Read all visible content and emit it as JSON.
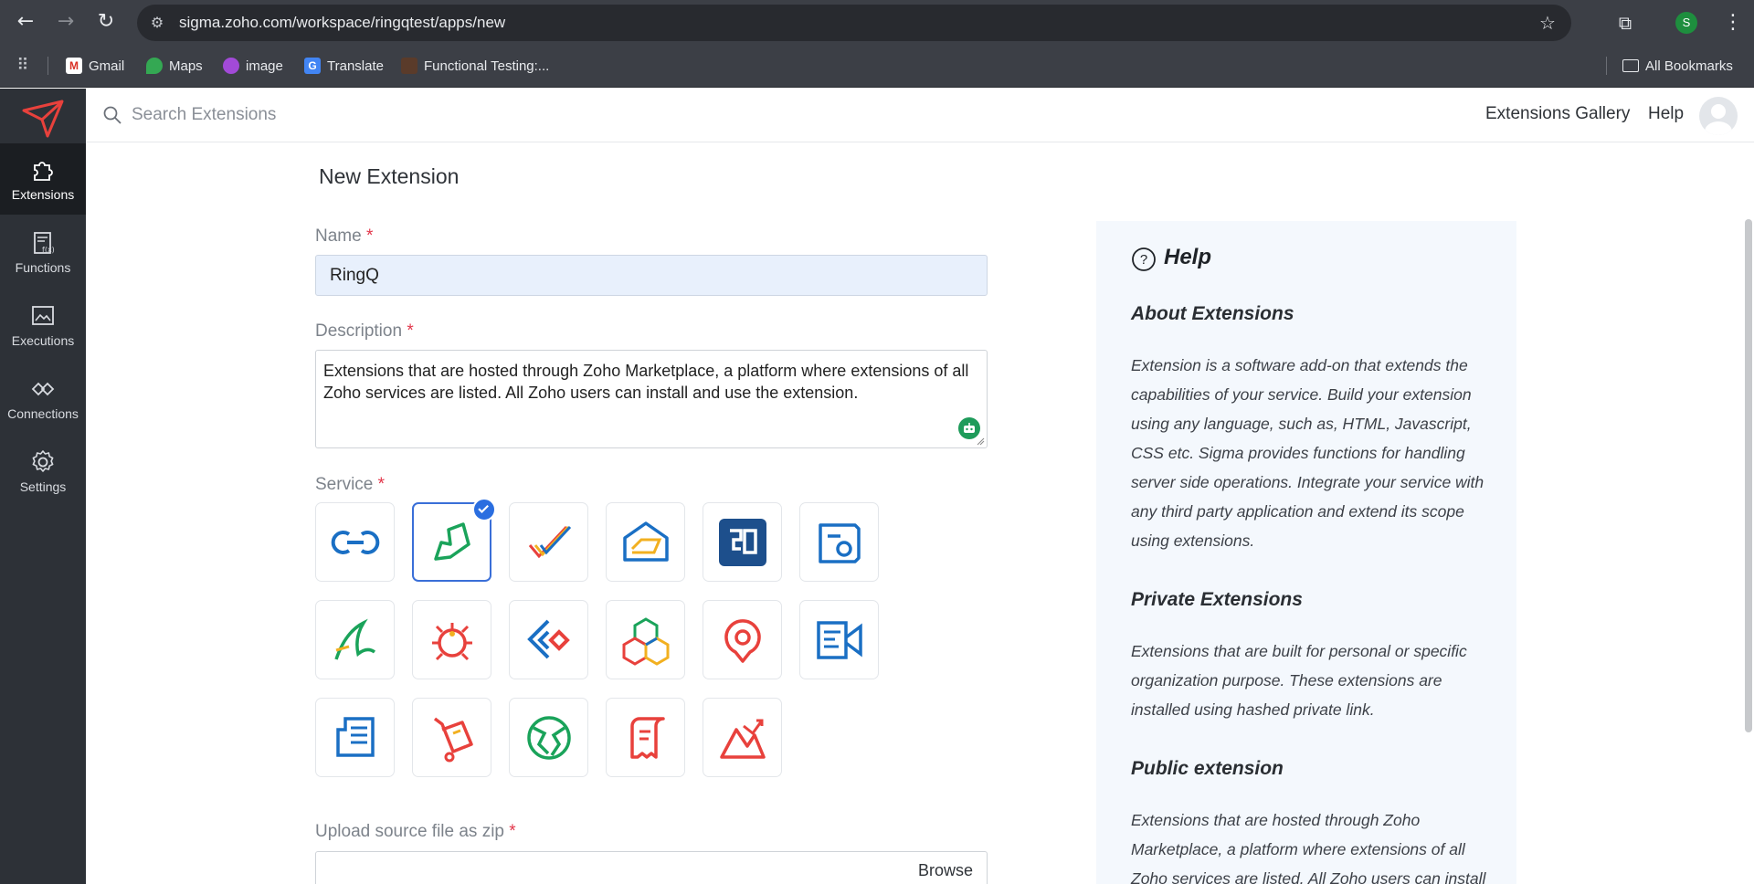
{
  "browser": {
    "url": "sigma.zoho.com/workspace/ringqtest/apps/new",
    "profile_initial": "S",
    "bookmarks": [
      {
        "label": "Gmail",
        "icon": "gmail-icon"
      },
      {
        "label": "Maps",
        "icon": "maps-icon"
      },
      {
        "label": "image",
        "icon": "image-icon"
      },
      {
        "label": "Translate",
        "icon": "translate-icon"
      },
      {
        "label": "Functional Testing:...",
        "icon": "functional-testing-icon"
      }
    ],
    "all_bookmarks": "All Bookmarks"
  },
  "sidebar": {
    "items": [
      {
        "label": "Extensions",
        "icon": "puzzle-icon",
        "active": true
      },
      {
        "label": "Functions",
        "icon": "functions-icon",
        "active": false
      },
      {
        "label": "Executions",
        "icon": "executions-icon",
        "active": false
      },
      {
        "label": "Connections",
        "icon": "connections-icon",
        "active": false
      },
      {
        "label": "Settings",
        "icon": "gear-icon",
        "active": false
      }
    ]
  },
  "topbar": {
    "search_placeholder": "Search Extensions",
    "gallery": "Extensions Gallery",
    "help": "Help"
  },
  "form": {
    "title": "New Extension",
    "name_label": "Name",
    "name_value": "RingQ",
    "description_label": "Description",
    "description_value": "Extensions that are hosted through Zoho Marketplace, a platform where extensions of all Zoho services are listed. All Zoho users can install and use the extension.",
    "service_label": "Service",
    "services": [
      {
        "name": "zoho-crm",
        "selected": false
      },
      {
        "name": "zoho-desk",
        "selected": true
      },
      {
        "name": "zoho-projects",
        "selected": false
      },
      {
        "name": "zoho-mail",
        "selected": false
      },
      {
        "name": "zoho-cliq",
        "selected": false
      },
      {
        "name": "zoho-bookings",
        "selected": false
      },
      {
        "name": "zoho-sign",
        "selected": false
      },
      {
        "name": "zoho-bugtracker",
        "selected": false
      },
      {
        "name": "zoho-workdrive",
        "selected": false
      },
      {
        "name": "zoho-creator",
        "selected": false
      },
      {
        "name": "zoho-recruit",
        "selected": false
      },
      {
        "name": "zoho-campaigns",
        "selected": false
      },
      {
        "name": "zoho-writer",
        "selected": false
      },
      {
        "name": "zoho-inventory",
        "selected": false
      },
      {
        "name": "zoho-sites",
        "selected": false
      },
      {
        "name": "zoho-invoice",
        "selected": false
      },
      {
        "name": "zoho-analytics",
        "selected": false
      }
    ],
    "upload_label": "Upload source file as zip",
    "browse": "Browse"
  },
  "help": {
    "title": "Help",
    "sections": [
      {
        "heading": "About Extensions",
        "text": "Extension is a software add-on that extends the capabilities of your service. Build your extension using any language, such as, HTML, Javascript, CSS etc. Sigma provides functions for handling server side operations. Integrate your service with any third party application and extend its scope using extensions."
      },
      {
        "heading": "Private Extensions",
        "text": "Extensions that are built for personal or specific organization purpose. These extensions are installed using hashed private link."
      },
      {
        "heading": "Public extension",
        "text": "Extensions that are hosted through Zoho Marketplace, a platform where extensions of all Zoho services are listed. All Zoho users can install"
      }
    ]
  },
  "colors": {
    "sidebar_bg": "#2d3137",
    "accent": "#2a6ee0",
    "required": "#e2364a",
    "help_bg": "#f4f8fd"
  }
}
